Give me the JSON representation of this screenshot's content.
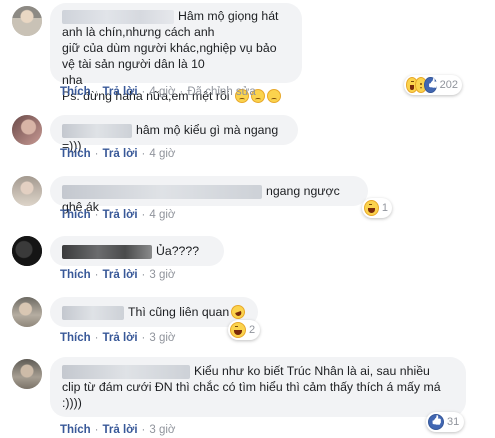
{
  "comments": [
    {
      "text_lines": [
        "Hâm mộ giọng hát anh là chín,nhưng cách anh",
        "giữ của dùm người khác,nghiệp vụ bảo vệ tài sản người dân là 10",
        "nha",
        "Ps: đừng haha nữa,em mệt rồi"
      ],
      "like": "Thích",
      "reply": "Trả lời",
      "time": "4 giờ",
      "edited": "Đã chỉnh sửa",
      "reaction_count": "202",
      "reaction_icons": [
        "haha-icon",
        "sad-icon",
        "like-icon"
      ]
    },
    {
      "text": "hâm mộ kiểu gì mà ngang =)))",
      "like": "Thích",
      "reply": "Trả lời",
      "time": "4 giờ"
    },
    {
      "text": "ngang ngược ghê ák",
      "like": "Thích",
      "reply": "Trả lời",
      "time": "4 giờ",
      "reaction_count": "1",
      "reaction_icons": [
        "haha-icon"
      ]
    },
    {
      "text": "Ủa????",
      "like": "Thích",
      "reply": "Trả lời",
      "time": "3 giờ"
    },
    {
      "text": "Thì cũng liên quan",
      "like": "Thích",
      "reply": "Trả lời",
      "time": "3 giờ",
      "reaction_count": "2",
      "reaction_icons": [
        "haha-icon"
      ]
    },
    {
      "text_lines": [
        "Kiểu như ko biết Trúc Nhân là ai, sau nhiều",
        "clip từ đám cưới ĐN thì chắc có tìm hiểu thì cảm thấy thích á mấy má",
        ":))))"
      ],
      "like": "Thích",
      "reply": "Trả lời",
      "time": "3 giờ",
      "reaction_count": "31",
      "reaction_icons": [
        "like-icon"
      ]
    }
  ],
  "colors": {
    "bubble": "#f2f3f5",
    "link": "#385898",
    "meta": "#90949c"
  }
}
